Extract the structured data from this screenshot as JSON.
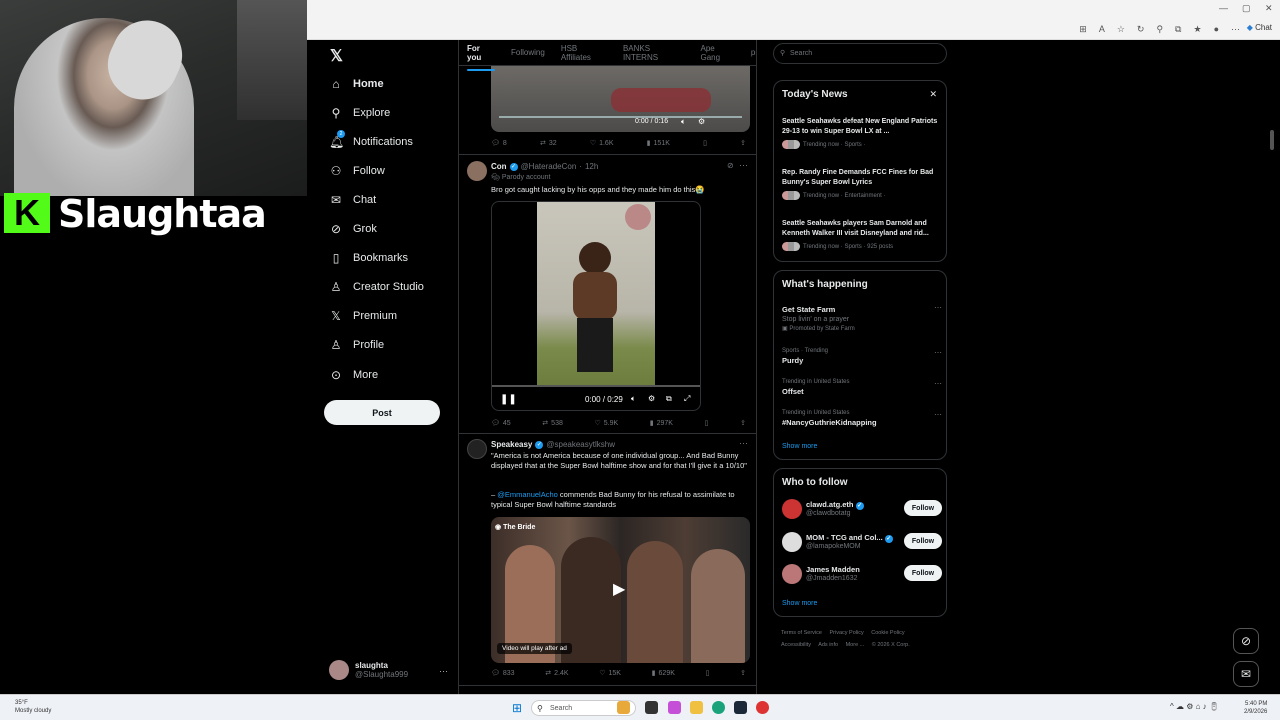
{
  "overlay": {
    "streamer_name": "Slaughtaa",
    "logo_letter": "K"
  },
  "browser": {
    "chat_label": "Chat"
  },
  "nav": {
    "items": [
      {
        "label": "Home",
        "icon": "home-icon"
      },
      {
        "label": "Explore",
        "icon": "search-icon"
      },
      {
        "label": "Notifications",
        "icon": "bell-icon",
        "badge": "2"
      },
      {
        "label": "Follow",
        "icon": "person-plus-icon"
      },
      {
        "label": "Chat",
        "icon": "chat-icon"
      },
      {
        "label": "Grok",
        "icon": "grok-icon"
      },
      {
        "label": "Bookmarks",
        "icon": "bookmark-icon"
      },
      {
        "label": "Creator Studio",
        "icon": "creator-studio-icon"
      },
      {
        "label": "Premium",
        "icon": "x-icon"
      },
      {
        "label": "Profile",
        "icon": "person-icon"
      },
      {
        "label": "More",
        "icon": "more-circle-icon"
      }
    ],
    "post_label": "Post",
    "account": {
      "name": "slaughta",
      "handle": "@Slaughta999"
    }
  },
  "timeline": {
    "tabs": [
      "For you",
      "Following",
      "HSB Affiliates",
      "BANKS INTERNS",
      "Ape Gang",
      "pr"
    ],
    "tweet0": {
      "video_time": "0:00 / 0:16",
      "actions": {
        "replies": "8",
        "reposts": "32",
        "likes": "1.6K",
        "views": "151K"
      }
    },
    "tweet1": {
      "name": "Con",
      "handle": "@HateradeCon",
      "time": "12h",
      "badge_text": "Parody account",
      "text": "Bro got caught lacking by his opps and they made him do this😭",
      "video_time": "0:00 / 0:29",
      "actions": {
        "replies": "45",
        "reposts": "538",
        "likes": "5.9K",
        "views": "297K"
      }
    },
    "tweet2": {
      "name": "Speakeasy",
      "handle": "@speakeasytlkshw",
      "text": "\"America is not America because of one individual group... And Bad Bunny displayed that at the Super Bowl halftime show and for that I'll give it a 10/10\"",
      "mention": "@EmmanuelAcho",
      "text2": " commends Bad Bunny for his refusal to assimilate to typical Super Bowl halftime standards",
      "video_label": "The Bride",
      "video_note": "Video will play after ad",
      "actions": {
        "replies": "833",
        "reposts": "2.4K",
        "likes": "15K",
        "views": "629K"
      }
    }
  },
  "right": {
    "search_placeholder": "Search",
    "todays_news": {
      "title": "Today's News",
      "items": [
        {
          "title": "Seattle Seahawks defeat New England Patriots 29-13 to win Super Bowl LX at ...",
          "meta": "Trending now · Sports ·"
        },
        {
          "title": "Rep. Randy Fine Demands FCC Fines for Bad Bunny's Super Bowl Lyrics",
          "meta": "Trending now · Entertainment ·"
        },
        {
          "title": "Seattle Seahawks players Sam Darnold and Kenneth Walker III visit Disneyland and rid...",
          "meta": "Trending now · Sports · 925 posts"
        }
      ]
    },
    "whats_happening": {
      "title": "What's happening",
      "trends": [
        {
          "category": "",
          "name": "Get State Farm",
          "desc": "Stop livin' on a prayer",
          "promo": "Promoted by State Farm"
        },
        {
          "category": "Sports · Trending",
          "name": "Purdy"
        },
        {
          "category": "Trending in United States",
          "name": "Offset"
        },
        {
          "category": "Trending in United States",
          "name": "#NancyGuthrieKidnapping"
        }
      ],
      "show_more": "Show more"
    },
    "who_to_follow": {
      "title": "Who to follow",
      "people": [
        {
          "name": "clawd.atg.eth",
          "handle": "@clawdbotatg",
          "button": "Follow"
        },
        {
          "name": "MOM - TCG and Col...",
          "handle": "@lamapokeMOM",
          "button": "Follow"
        },
        {
          "name": "James Madden",
          "handle": "@Jmadden1632",
          "button": "Follow"
        }
      ],
      "show_more": "Show more"
    },
    "footer": [
      "Terms of Service",
      "Privacy Policy",
      "Cookie Policy",
      "Accessibility",
      "Ads info",
      "More ...",
      "© 2026 X Corp."
    ]
  },
  "taskbar": {
    "weather_temp": "35°F",
    "weather_desc": "Mostly cloudy",
    "search_label": "Search",
    "time": "5:40 PM",
    "date": "2/9/2026"
  }
}
